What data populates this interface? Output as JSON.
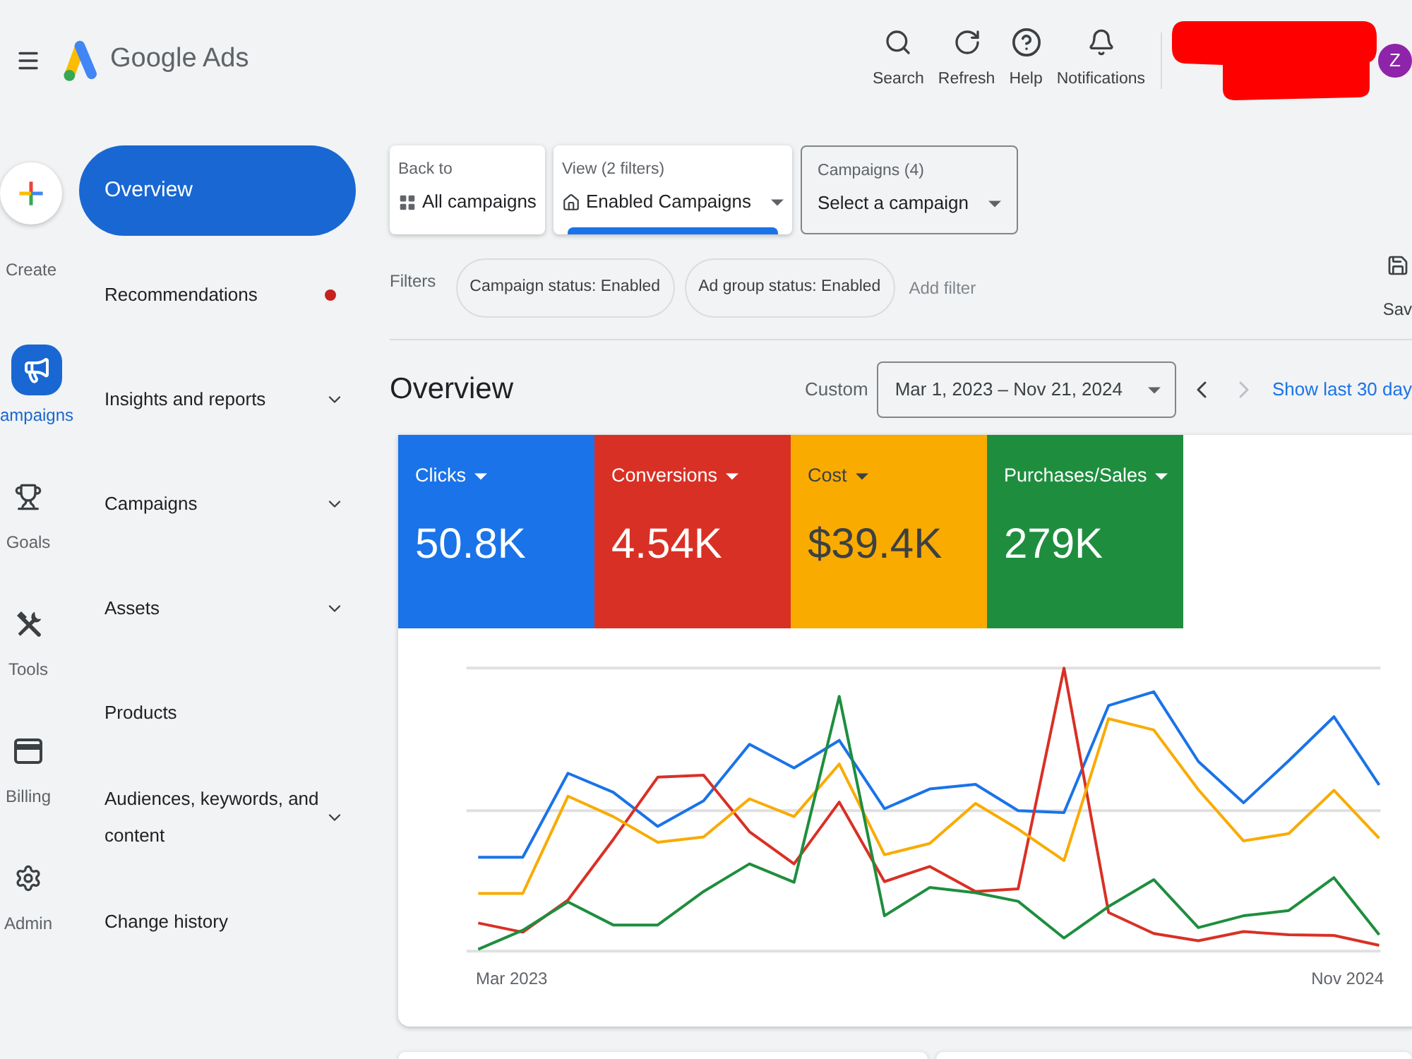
{
  "header": {
    "app_name": "Google Ads",
    "actions": [
      {
        "label": "Search"
      },
      {
        "label": "Refresh"
      },
      {
        "label": "Help"
      },
      {
        "label": "Notifications"
      }
    ],
    "avatar": "Z"
  },
  "rail": {
    "create": "Create",
    "items": [
      {
        "label": "ampaigns",
        "selected": true
      },
      {
        "label": "Goals",
        "selected": false
      },
      {
        "label": "Tools",
        "selected": false
      },
      {
        "label": "Billing",
        "selected": false
      },
      {
        "label": "Admin",
        "selected": false
      }
    ]
  },
  "nav": [
    {
      "label": "Overview",
      "selected": true,
      "expandable": false,
      "notification": false
    },
    {
      "label": "Recommendations",
      "selected": false,
      "expandable": false,
      "notification": true
    },
    {
      "label": "Insights and reports",
      "selected": false,
      "expandable": true,
      "notification": false
    },
    {
      "label": "Campaigns",
      "selected": false,
      "expandable": true,
      "notification": false
    },
    {
      "label": "Assets",
      "selected": false,
      "expandable": true,
      "notification": false
    },
    {
      "label": "Products",
      "selected": false,
      "expandable": false,
      "notification": false
    },
    {
      "label": "Audiences, keywords, and content",
      "selected": false,
      "expandable": true,
      "notification": false
    },
    {
      "label": "Change history",
      "selected": false,
      "expandable": false,
      "notification": false
    }
  ],
  "selectors": [
    {
      "kind": "back",
      "caption": "Back to",
      "label": "All campaigns",
      "selected": false
    },
    {
      "kind": "view",
      "caption": "View (2 filters)",
      "label": "Enabled Campaigns",
      "selected": true
    },
    {
      "kind": "dropdown",
      "caption": "Campaigns (4)",
      "label": "Select a campaign",
      "selected": false
    }
  ],
  "filters": {
    "label": "Filters",
    "chips": [
      "Campaign status: Enabled",
      "Ad group status: Enabled"
    ],
    "add": "Add filter"
  },
  "save": "Sav",
  "overview": {
    "title": "Overview",
    "range_label": "Custom",
    "date_range": "Mar 1, 2023 – Nov 21, 2024",
    "previous": {
      "disabled": false
    },
    "next": {
      "disabled": true
    },
    "quick_link": "Show last 30 day"
  },
  "metrics": [
    {
      "label": "Clicks",
      "value": "50.8K",
      "color": "#1a73e8"
    },
    {
      "label": "Conversions",
      "value": "4.54K",
      "color": "#d93025"
    },
    {
      "label": "Cost",
      "value": "$39.4K",
      "color": "#f9ab00"
    },
    {
      "label": "Purchases/Sales",
      "value": "279K",
      "color": "#1e8e3e"
    }
  ],
  "chart": {
    "x_labels": [
      "Mar 2023",
      "Nov 2024"
    ]
  }
}
